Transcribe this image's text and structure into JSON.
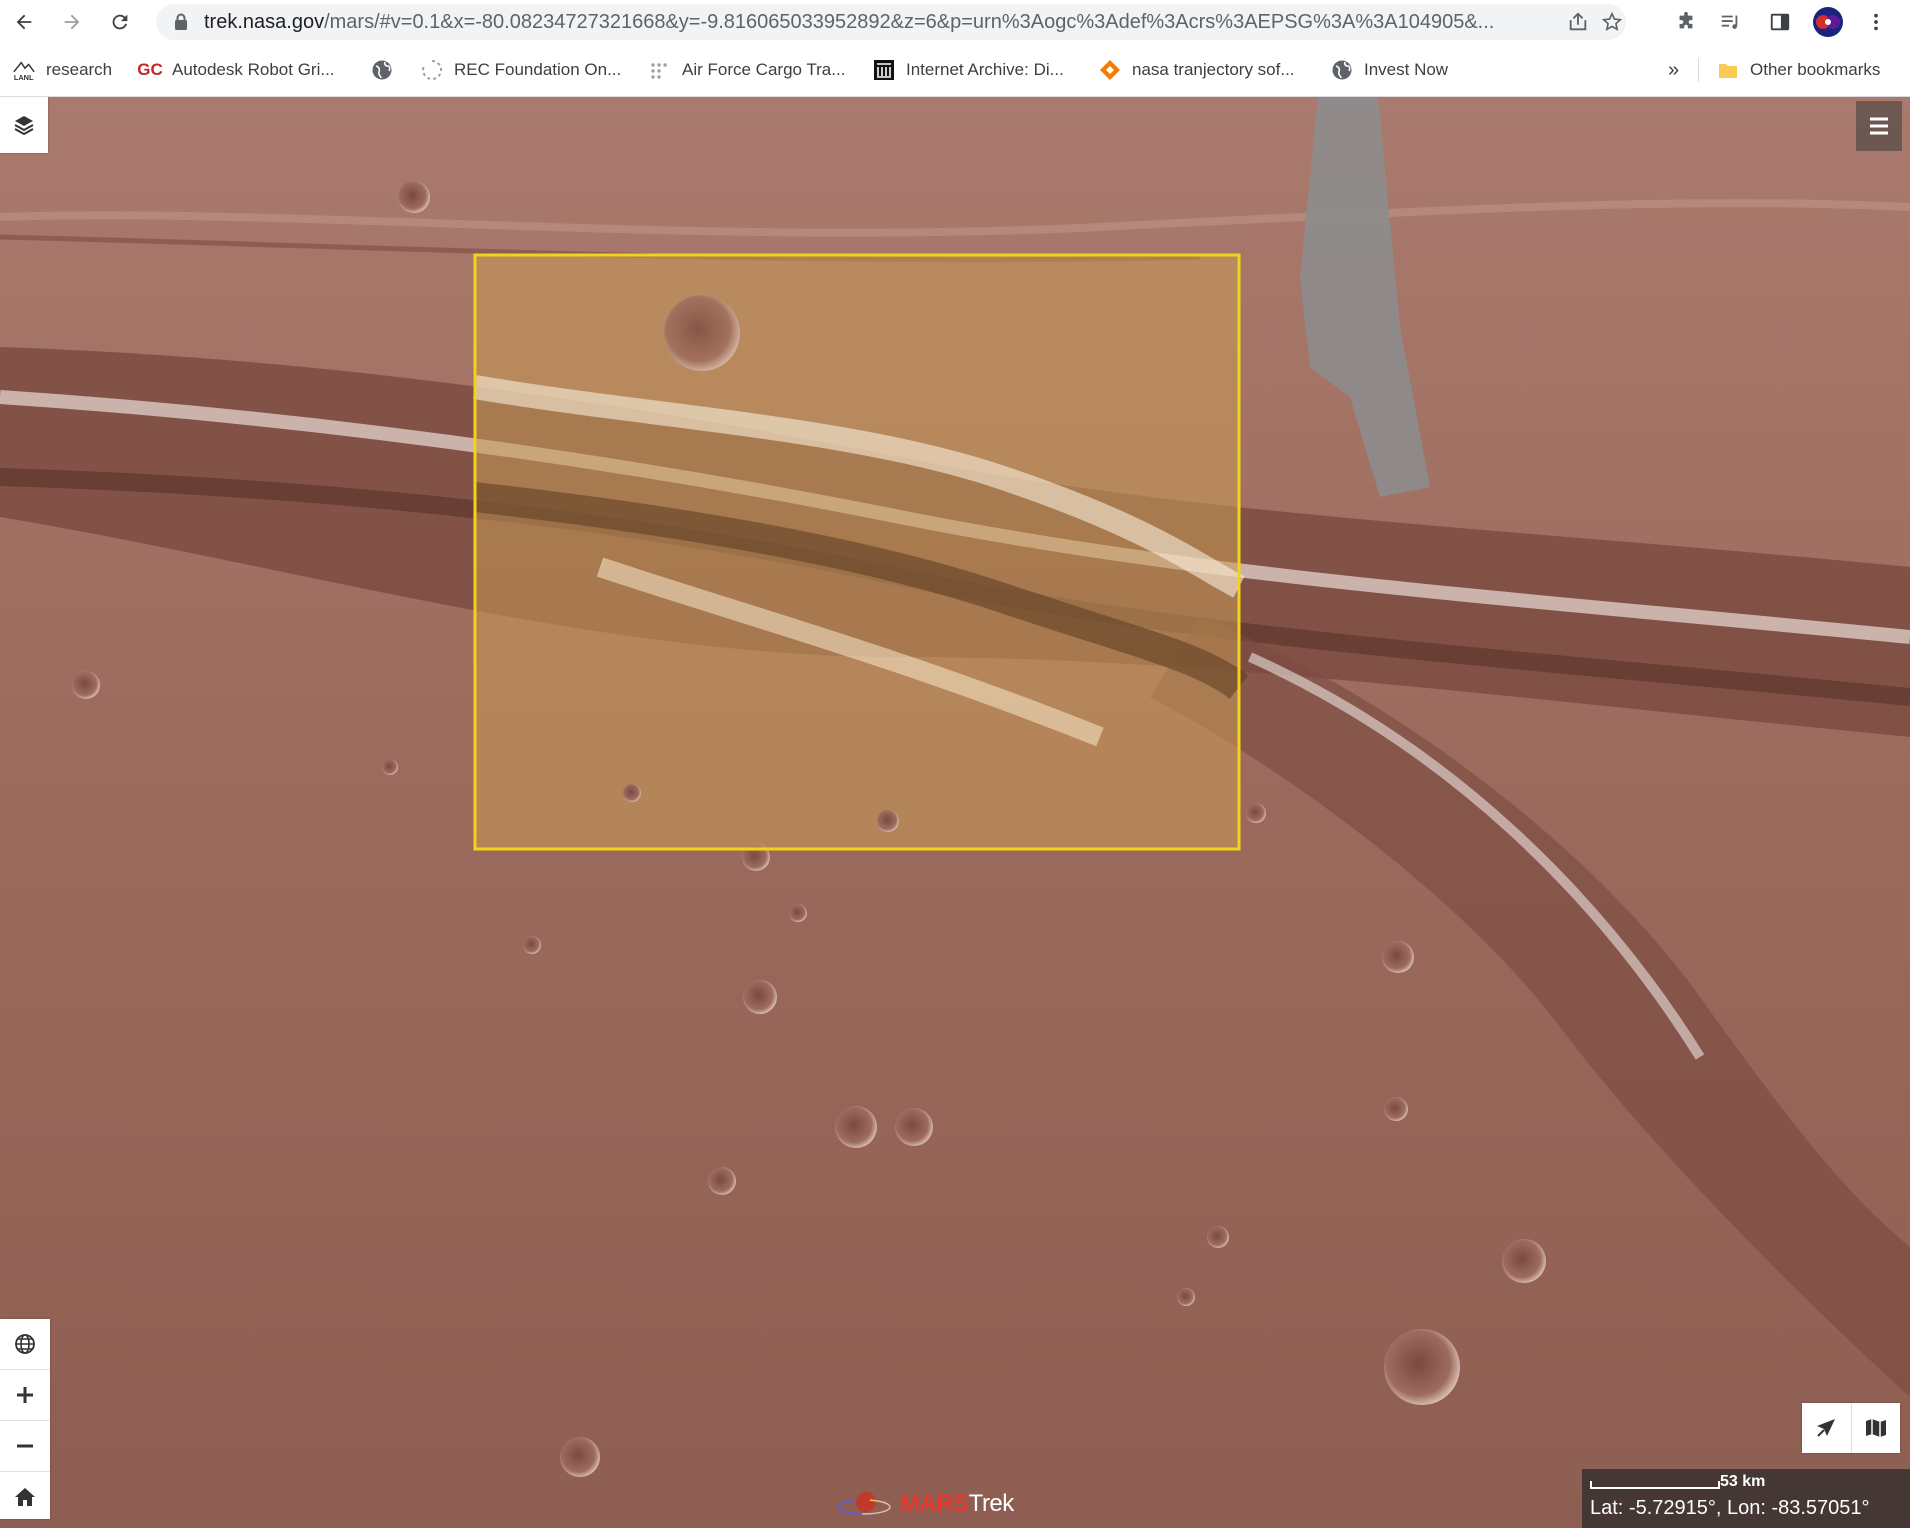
{
  "browser": {
    "url_host": "trek.nasa.gov",
    "url_rest": "/mars/#v=0.1&x=-80.08234727321668&y=-9.816065033952892&z=6&p=urn%3Aogc%3Adef%3Acrs%3AEPSG%3A%3A104905&...",
    "bookmarks": [
      {
        "label": "research",
        "icon": "lanl-logo-icon"
      },
      {
        "label": "Autodesk Robot Gri...",
        "icon": "gc-logo-icon",
        "icon_text": "GC"
      },
      {
        "label": "",
        "icon": "globe-icon"
      },
      {
        "label": "REC Foundation On...",
        "icon": "spinner-icon"
      },
      {
        "label": "Air Force Cargo Tra...",
        "icon": "grid-dots-icon"
      },
      {
        "label": "Internet Archive: Di...",
        "icon": "archive-icon"
      },
      {
        "label": "nasa tranjectory sof...",
        "icon": "diamond-logo-icon"
      },
      {
        "label": "Invest Now",
        "icon": "globe-icon"
      }
    ],
    "overflow_label": "»",
    "other_bookmarks": "Other bookmarks"
  },
  "map": {
    "brand_mars": "MARS",
    "brand_trek": "Trek",
    "scale_label": "53 km",
    "coordinates": "Lat: -5.72915°, Lon: -83.57051°",
    "colors": {
      "selection_box": "#f2d21b",
      "mars_surface": "#9c6a5c",
      "brand_red": "#e03a2f"
    }
  }
}
